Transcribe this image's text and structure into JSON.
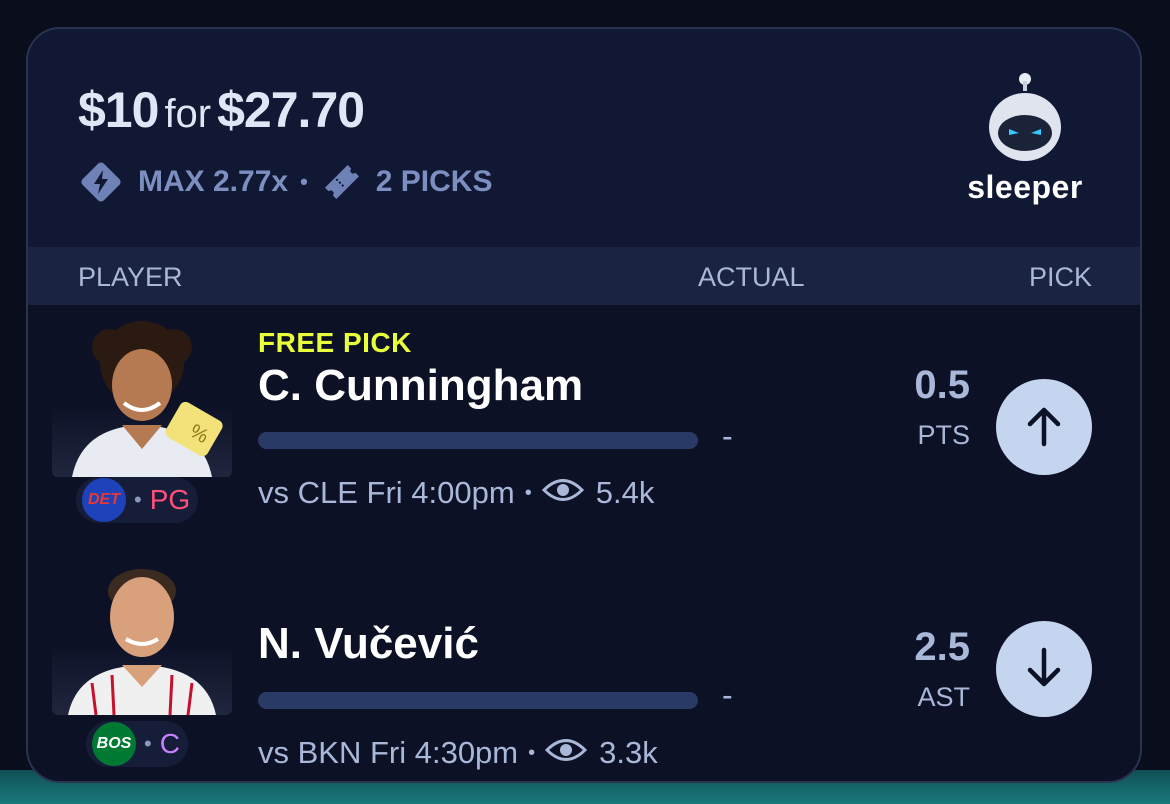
{
  "header": {
    "stake": "$10",
    "for_label": "for",
    "payout": "$27.70",
    "max_label": "MAX 2.77x",
    "picks_label": "2 PICKS",
    "bolt_icon": "bolt-diamond-icon",
    "ticket_icon": "ticket-icon"
  },
  "brand": {
    "name": "sleeper",
    "icon": "sleeper-robot-icon"
  },
  "table_header": {
    "player": "PLAYER",
    "actual": "ACTUAL",
    "pick": "PICK"
  },
  "picks": [
    {
      "badge": "FREE PICK",
      "name": "C. Cunningham",
      "team": "DET",
      "team_color": "#1d42ba",
      "position": "PG",
      "position_color": "#ff4f7b",
      "actual": "-",
      "line": "0.5",
      "stat": "PTS",
      "game": "vs CLE Fri 4:00pm",
      "views": "5.4k",
      "direction": "up",
      "direction_icon": "arrow-up-icon"
    },
    {
      "badge": "",
      "name": "N. Vučević",
      "team": "BOS",
      "team_color": "#007a33",
      "position": "C",
      "position_color": "#c680ff",
      "actual": "-",
      "line": "2.5",
      "stat": "AST",
      "game": "vs BKN Fri 4:30pm",
      "views": "3.3k",
      "direction": "down",
      "direction_icon": "arrow-down-icon"
    }
  ],
  "colors": {
    "background": "#0a0d1c",
    "card": "#0c1126",
    "header": "#111833",
    "muted": "#7d8fc0",
    "free_pick": "#e9ff3a",
    "pick_button": "#c5d5f0"
  }
}
